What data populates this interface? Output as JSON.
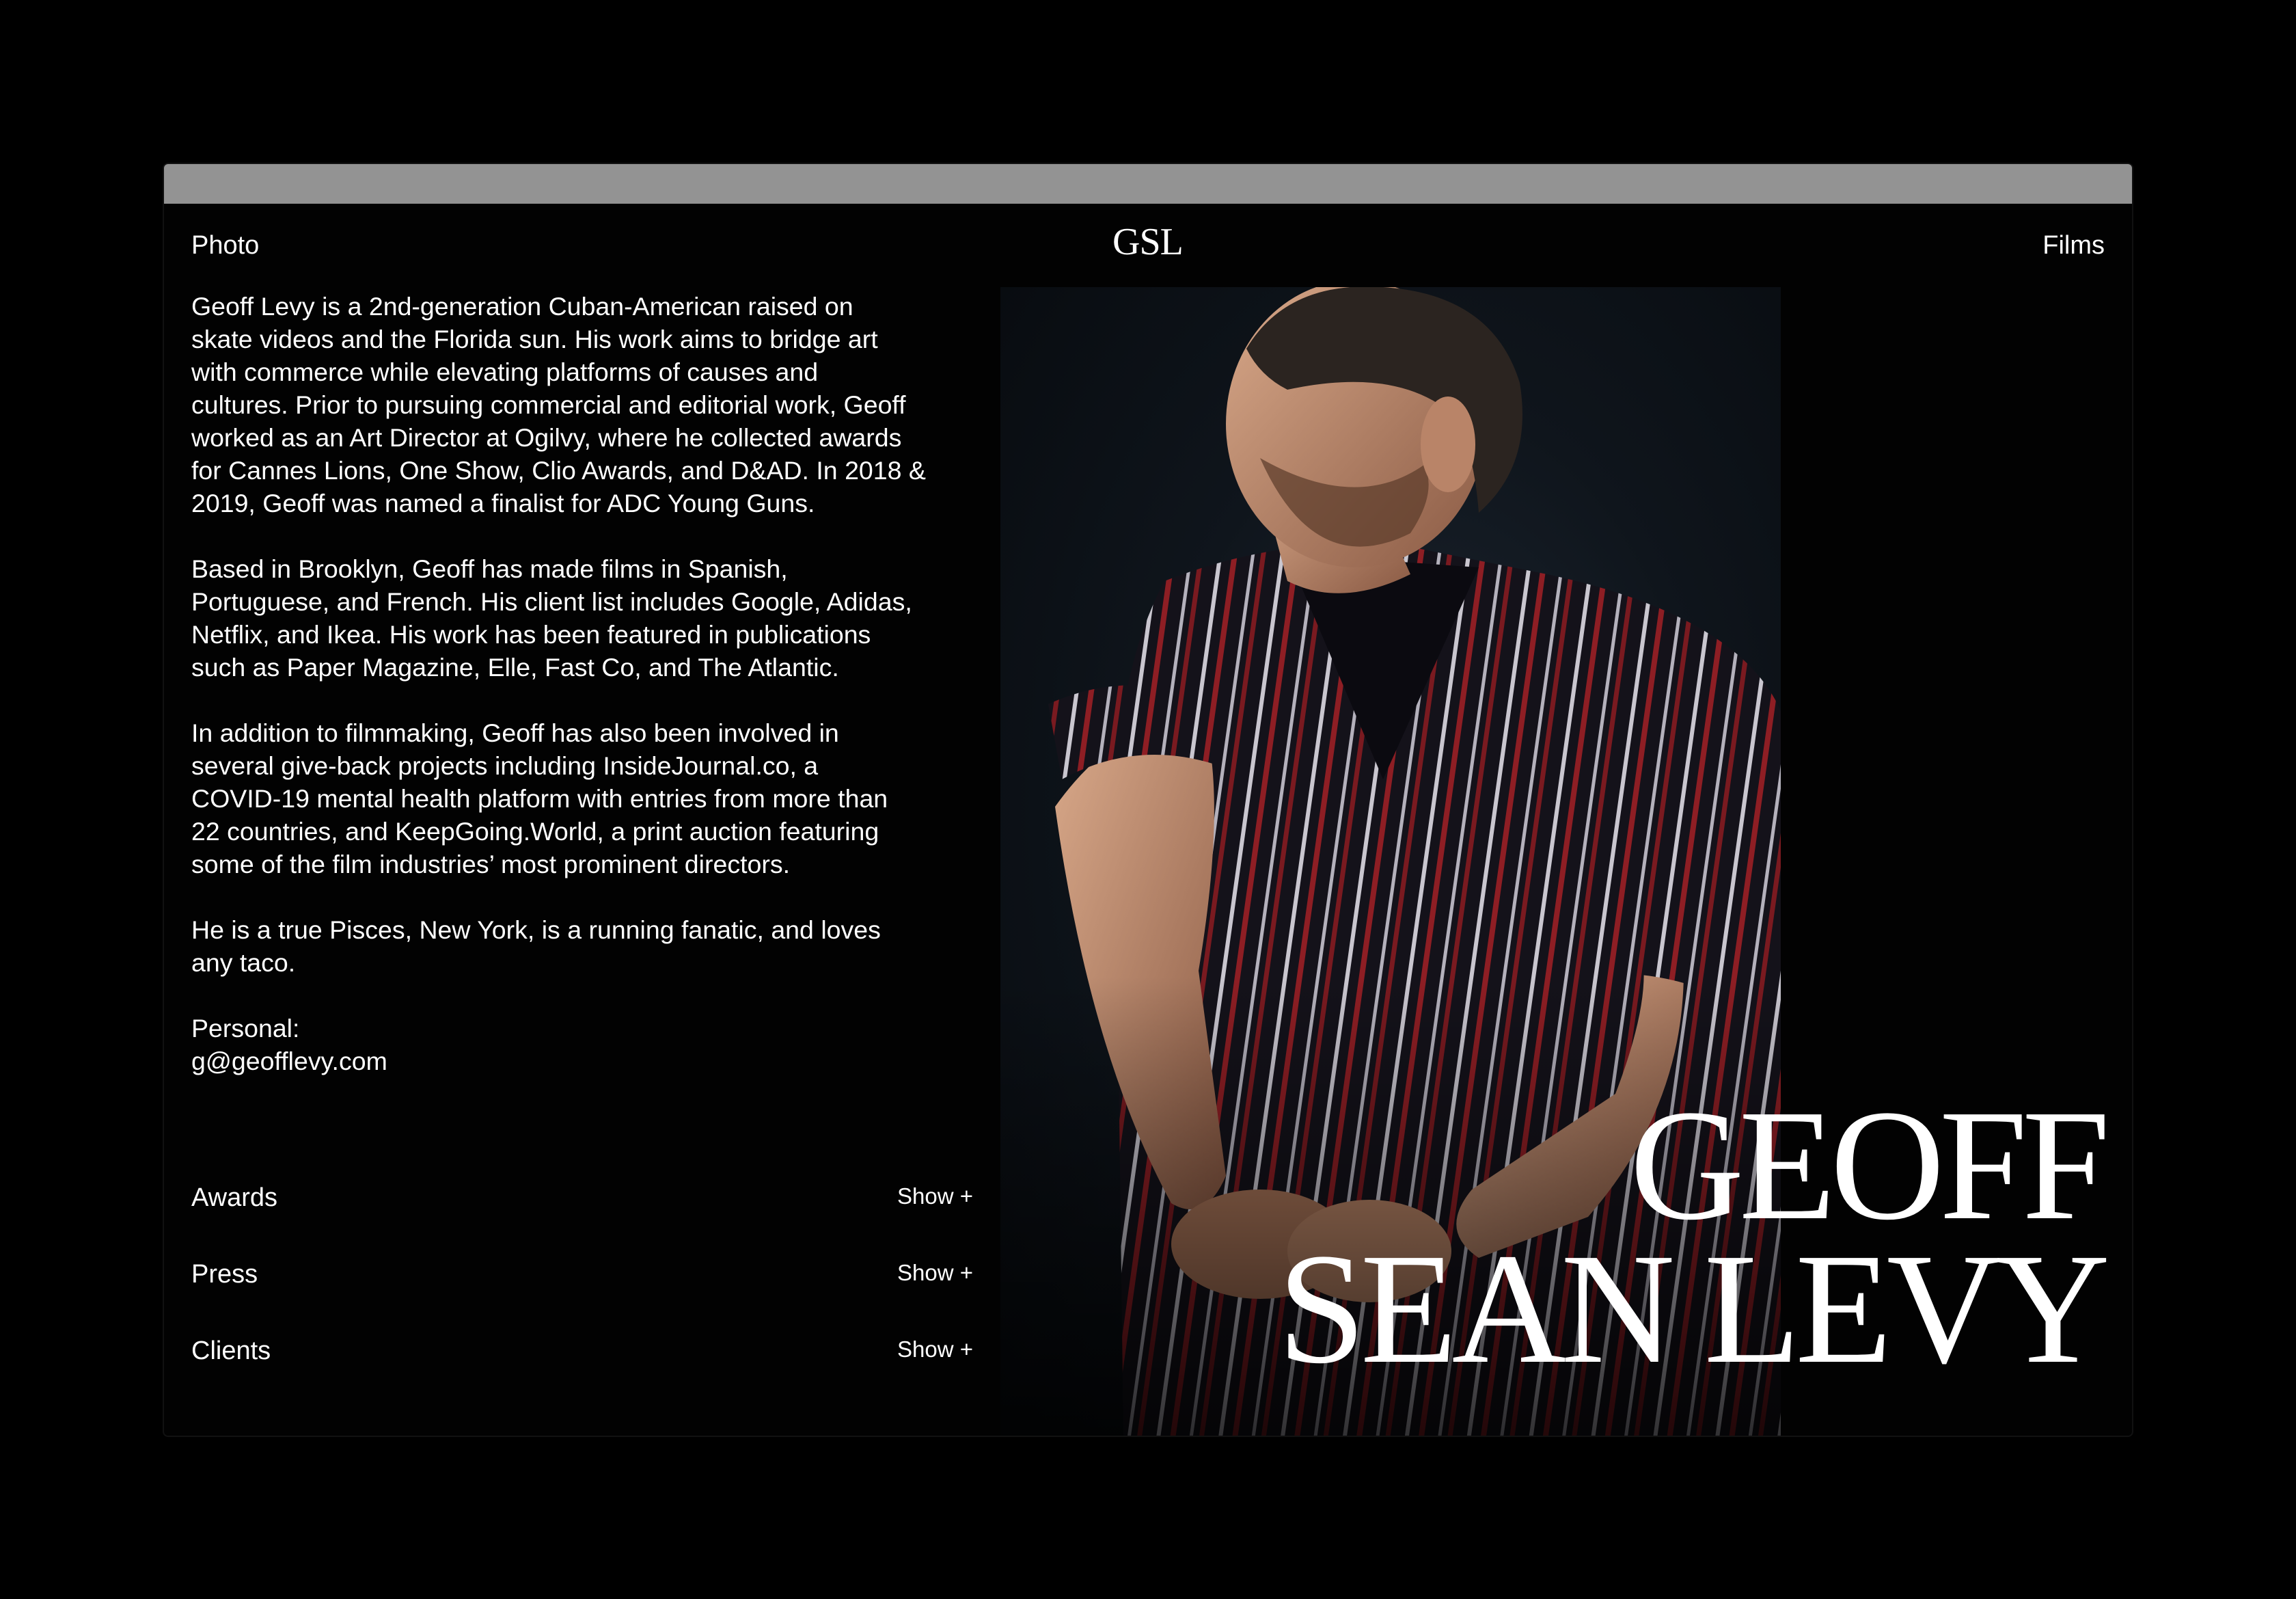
{
  "nav": {
    "left_label": "Photo",
    "logo": "GSL",
    "right_label": "Films"
  },
  "bio": {
    "paragraphs": [
      "Geoff Levy is a 2nd-generation Cuban-American raised on\nskate videos and the Florida sun.  His work aims to bridge art\nwith commerce while elevating platforms of causes and\ncultures. Prior to pursuing commercial and editorial work, Geoff\nworked as an Art Director at Ogilvy, where he collected awards\nfor Cannes Lions, One Show, Clio Awards, and D&AD. In 2018 &\n2019, Geoff was named a finalist for ADC Young Guns.",
      "Based in Brooklyn, Geoff has made films in Spanish,\nPortuguese, and French. His client list includes Google, Adidas,\nNetflix, and Ikea. His work has been featured in publications\nsuch as Paper Magazine, Elle, Fast Co, and The Atlantic.",
      "In addition to filmmaking, Geoff has also been involved in\nseveral give-back projects including InsideJournal.co, a\nCOVID-19 mental health platform with entries from more than\n22 countries, and KeepGoing.World, a print auction featuring\nsome of the film industries’ most prominent directors.",
      "He is a true Pisces, New York, is a running fanatic, and loves\nany taco."
    ],
    "contact_label": "Personal:",
    "contact_email": "g@geofflevy.com"
  },
  "sections": [
    {
      "title": "Awards",
      "toggle": "Show +"
    },
    {
      "title": "Press",
      "toggle": "Show +"
    },
    {
      "title": "Clients",
      "toggle": "Show +"
    }
  ],
  "headline": {
    "line1": "GEOFF",
    "line2": "SEAN LEVY"
  },
  "colors": {
    "background": "#000000",
    "titlebar": "#939393",
    "text": "#ffffff"
  }
}
